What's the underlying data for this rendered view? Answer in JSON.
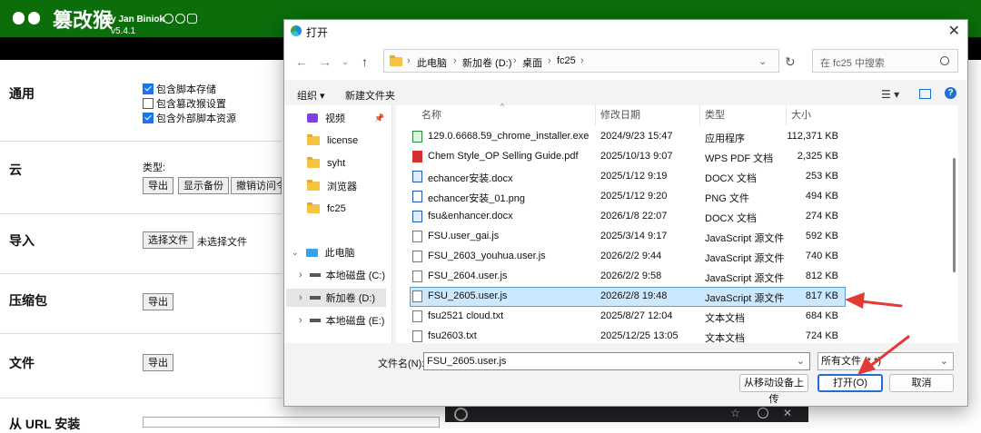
{
  "app": {
    "title": "篡改猴",
    "by": "by Jan Biniok",
    "version": "v5.4.1",
    "sections": [
      {
        "title": "通用"
      },
      {
        "title": "云"
      },
      {
        "title": "导入"
      },
      {
        "title": "压缩包"
      },
      {
        "title": "文件"
      },
      {
        "title": "从 URL 安装"
      }
    ],
    "general_checks": [
      {
        "label": "包含脚本存储",
        "checked": true
      },
      {
        "label": "包含篡改猴设置",
        "checked": false
      },
      {
        "label": "包含外部脚本资源",
        "checked": true
      }
    ],
    "cloud": {
      "type_label": "类型:",
      "export": "导出",
      "show_backup": "显示备份",
      "revoke": "撤销访问令"
    },
    "import": {
      "choose": "选择文件",
      "none": "未选择文件"
    },
    "zip_export": "导出",
    "file_export": "导出"
  },
  "dialog": {
    "title": "打开",
    "breadcrumb": [
      "此电脑",
      "新加卷 (D:)",
      "桌面",
      "fc25"
    ],
    "search_placeholder": "在 fc25 中搜索",
    "toolbar": {
      "organize": "组织 ▾",
      "new_folder": "新建文件夹"
    },
    "sidebar": [
      {
        "label": "视频",
        "icon": "video-folder-icon"
      },
      {
        "label": "license",
        "icon": "folder-icon"
      },
      {
        "label": "syht",
        "icon": "folder-icon"
      },
      {
        "label": "浏览器",
        "icon": "folder-icon"
      },
      {
        "label": "fc25",
        "icon": "folder-icon"
      },
      {
        "label": "此电脑",
        "icon": "computer-icon"
      },
      {
        "label": "本地磁盘 (C:)",
        "icon": "drive-icon"
      },
      {
        "label": "新加卷 (D:)",
        "icon": "drive-icon"
      },
      {
        "label": "本地磁盘 (E:)",
        "icon": "drive-icon"
      }
    ],
    "columns": [
      "名称",
      "修改日期",
      "类型",
      "大小"
    ],
    "files": [
      {
        "name": "129.0.6668.59_chrome_installer.exe",
        "date": "2024/9/23 15:47",
        "type": "应用程序",
        "size": "112,371 KB"
      },
      {
        "name": "Chem Style_OP Selling Guide.pdf",
        "date": "2025/10/13 9:07",
        "type": "WPS PDF 文档",
        "size": "2,325 KB"
      },
      {
        "name": "echancer安装.docx",
        "date": "2025/1/12 9:19",
        "type": "DOCX 文档",
        "size": "253 KB"
      },
      {
        "name": "echancer安装_01.png",
        "date": "2025/1/12 9:20",
        "type": "PNG 文件",
        "size": "494 KB"
      },
      {
        "name": "fsu&enhancer.docx",
        "date": "2026/1/8 22:07",
        "type": "DOCX 文档",
        "size": "274 KB"
      },
      {
        "name": "FSU.user_gai.js",
        "date": "2025/3/14 9:17",
        "type": "JavaScript 源文件",
        "size": "592 KB"
      },
      {
        "name": "FSU_2603_youhua.user.js",
        "date": "2026/2/2 9:44",
        "type": "JavaScript 源文件",
        "size": "740 KB"
      },
      {
        "name": "FSU_2604.user.js",
        "date": "2026/2/2 9:58",
        "type": "JavaScript 源文件",
        "size": "812 KB"
      },
      {
        "name": "FSU_2605.user.js",
        "date": "2026/2/8 19:48",
        "type": "JavaScript 源文件",
        "size": "817 KB"
      },
      {
        "name": "fsu2521 cloud.txt",
        "date": "2025/8/27 12:04",
        "type": "文本文档",
        "size": "684 KB"
      },
      {
        "name": "fsu2603.txt",
        "date": "2025/12/25 13:05",
        "type": "文本文档",
        "size": "724 KB"
      }
    ],
    "filename_label": "文件名(N):",
    "filename_value": "FSU_2605.user.js",
    "filetype_value": "所有文件 (*.*)",
    "upload_button": "从移动设备上传",
    "open_button": "打开(O)",
    "cancel_button": "取消"
  }
}
